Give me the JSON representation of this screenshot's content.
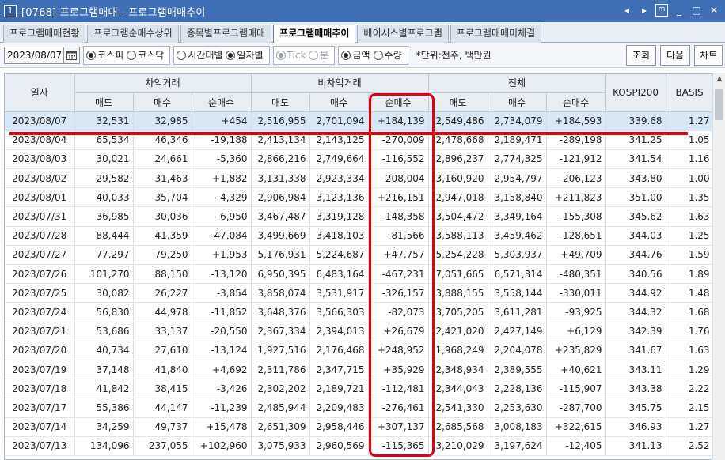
{
  "window": {
    "number": "1",
    "title": "[0768] 프로그램매매 - 프로그램매매추이",
    "controls": [
      "◂",
      "▸",
      "m",
      "_",
      "□",
      "✕"
    ]
  },
  "tabs": [
    {
      "label": "프로그램매매현황",
      "active": false
    },
    {
      "label": "프로그램순매수상위",
      "active": false
    },
    {
      "label": "종목별프로그램매매",
      "active": false
    },
    {
      "label": "프로그램매매추이",
      "active": true
    },
    {
      "label": "베이시스별프로그램",
      "active": false
    },
    {
      "label": "프로그램매매미체결",
      "active": false
    }
  ],
  "toolbar": {
    "date_value": "2023/08/07",
    "market": [
      {
        "label": "코스피",
        "selected": true
      },
      {
        "label": "코스닥",
        "selected": false
      }
    ],
    "period": [
      {
        "label": "시간대별",
        "selected": false
      },
      {
        "label": "일자별",
        "selected": true
      }
    ],
    "tick": [
      {
        "label": "Tick",
        "selected": true
      },
      {
        "label": "분",
        "selected": false
      }
    ],
    "amount_type": [
      {
        "label": "금액",
        "selected": true
      },
      {
        "label": "수량",
        "selected": false
      }
    ],
    "unit_note": "*단위:천주, 백만원",
    "search_label": "조회",
    "next_label": "다음",
    "chart_label": "차트"
  },
  "grid": {
    "headers": {
      "date": "일자",
      "arbitrage": "차익거래",
      "non_arbitrage": "비차익거래",
      "total": "전체",
      "kospi200": "KOSPI200",
      "basis": "BASIS",
      "sell": "매도",
      "buy": "매수",
      "net": "순매수"
    },
    "rows": [
      {
        "date": "2023/08/07",
        "a_sell": "32,531",
        "a_buy": "32,985",
        "a_net": "+454",
        "n_sell": "2,516,955",
        "n_buy": "2,701,094",
        "n_net": "+184,139",
        "t_sell": "2,549,486",
        "t_buy": "2,734,079",
        "t_net": "+184,593",
        "kospi": "339.68",
        "basis": "1.27"
      },
      {
        "date": "2023/08/04",
        "a_sell": "65,534",
        "a_buy": "46,346",
        "a_net": "-19,188",
        "n_sell": "2,413,134",
        "n_buy": "2,143,125",
        "n_net": "-270,009",
        "t_sell": "2,478,668",
        "t_buy": "2,189,471",
        "t_net": "-289,198",
        "kospi": "341.25",
        "basis": "1.05"
      },
      {
        "date": "2023/08/03",
        "a_sell": "30,021",
        "a_buy": "24,661",
        "a_net": "-5,360",
        "n_sell": "2,866,216",
        "n_buy": "2,749,664",
        "n_net": "-116,552",
        "t_sell": "2,896,237",
        "t_buy": "2,774,325",
        "t_net": "-121,912",
        "kospi": "341.54",
        "basis": "1.16"
      },
      {
        "date": "2023/08/02",
        "a_sell": "29,582",
        "a_buy": "31,463",
        "a_net": "+1,882",
        "n_sell": "3,131,338",
        "n_buy": "2,923,334",
        "n_net": "-208,004",
        "t_sell": "3,160,920",
        "t_buy": "2,954,797",
        "t_net": "-206,123",
        "kospi": "343.80",
        "basis": "1.00"
      },
      {
        "date": "2023/08/01",
        "a_sell": "40,033",
        "a_buy": "35,704",
        "a_net": "-4,329",
        "n_sell": "2,906,984",
        "n_buy": "3,123,136",
        "n_net": "+216,151",
        "t_sell": "2,947,018",
        "t_buy": "3,158,840",
        "t_net": "+211,823",
        "kospi": "351.00",
        "basis": "1.35"
      },
      {
        "date": "2023/07/31",
        "a_sell": "36,985",
        "a_buy": "30,036",
        "a_net": "-6,950",
        "n_sell": "3,467,487",
        "n_buy": "3,319,128",
        "n_net": "-148,358",
        "t_sell": "3,504,472",
        "t_buy": "3,349,164",
        "t_net": "-155,308",
        "kospi": "345.62",
        "basis": "1.63"
      },
      {
        "date": "2023/07/28",
        "a_sell": "88,444",
        "a_buy": "41,359",
        "a_net": "-47,084",
        "n_sell": "3,499,669",
        "n_buy": "3,418,103",
        "n_net": "-81,566",
        "t_sell": "3,588,113",
        "t_buy": "3,459,462",
        "t_net": "-128,651",
        "kospi": "344.03",
        "basis": "1.25"
      },
      {
        "date": "2023/07/27",
        "a_sell": "77,297",
        "a_buy": "79,250",
        "a_net": "+1,953",
        "n_sell": "5,176,931",
        "n_buy": "5,224,687",
        "n_net": "+47,757",
        "t_sell": "5,254,228",
        "t_buy": "5,303,937",
        "t_net": "+49,709",
        "kospi": "344.76",
        "basis": "1.59"
      },
      {
        "date": "2023/07/26",
        "a_sell": "101,270",
        "a_buy": "88,150",
        "a_net": "-13,120",
        "n_sell": "6,950,395",
        "n_buy": "6,483,164",
        "n_net": "-467,231",
        "t_sell": "7,051,665",
        "t_buy": "6,571,314",
        "t_net": "-480,351",
        "kospi": "340.56",
        "basis": "1.89"
      },
      {
        "date": "2023/07/25",
        "a_sell": "30,082",
        "a_buy": "26,227",
        "a_net": "-3,854",
        "n_sell": "3,858,074",
        "n_buy": "3,531,917",
        "n_net": "-326,157",
        "t_sell": "3,888,155",
        "t_buy": "3,558,144",
        "t_net": "-330,011",
        "kospi": "344.92",
        "basis": "1.48"
      },
      {
        "date": "2023/07/24",
        "a_sell": "56,830",
        "a_buy": "44,978",
        "a_net": "-11,852",
        "n_sell": "3,648,376",
        "n_buy": "3,566,303",
        "n_net": "-82,073",
        "t_sell": "3,705,205",
        "t_buy": "3,611,281",
        "t_net": "-93,925",
        "kospi": "344.32",
        "basis": "1.68"
      },
      {
        "date": "2023/07/21",
        "a_sell": "53,686",
        "a_buy": "33,137",
        "a_net": "-20,550",
        "n_sell": "2,367,334",
        "n_buy": "2,394,013",
        "n_net": "+26,679",
        "t_sell": "2,421,020",
        "t_buy": "2,427,149",
        "t_net": "+6,129",
        "kospi": "342.39",
        "basis": "1.76"
      },
      {
        "date": "2023/07/20",
        "a_sell": "40,734",
        "a_buy": "27,610",
        "a_net": "-13,124",
        "n_sell": "1,927,516",
        "n_buy": "2,176,468",
        "n_net": "+248,952",
        "t_sell": "1,968,249",
        "t_buy": "2,204,078",
        "t_net": "+235,829",
        "kospi": "341.67",
        "basis": "1.63"
      },
      {
        "date": "2023/07/19",
        "a_sell": "37,148",
        "a_buy": "41,840",
        "a_net": "+4,692",
        "n_sell": "2,311,786",
        "n_buy": "2,347,715",
        "n_net": "+35,929",
        "t_sell": "2,348,934",
        "t_buy": "2,389,555",
        "t_net": "+40,621",
        "kospi": "343.11",
        "basis": "1.29"
      },
      {
        "date": "2023/07/18",
        "a_sell": "41,842",
        "a_buy": "38,415",
        "a_net": "-3,426",
        "n_sell": "2,302,202",
        "n_buy": "2,189,721",
        "n_net": "-112,481",
        "t_sell": "2,344,043",
        "t_buy": "2,228,136",
        "t_net": "-115,907",
        "kospi": "343.38",
        "basis": "2.22"
      },
      {
        "date": "2023/07/17",
        "a_sell": "55,386",
        "a_buy": "44,147",
        "a_net": "-11,239",
        "n_sell": "2,485,944",
        "n_buy": "2,209,483",
        "n_net": "-276,461",
        "t_sell": "2,541,330",
        "t_buy": "2,253,630",
        "t_net": "-287,700",
        "kospi": "345.75",
        "basis": "2.15"
      },
      {
        "date": "2023/07/14",
        "a_sell": "34,259",
        "a_buy": "49,737",
        "a_net": "+15,478",
        "n_sell": "2,651,309",
        "n_buy": "2,958,446",
        "n_net": "+307,137",
        "t_sell": "2,685,568",
        "t_buy": "3,008,183",
        "t_net": "+322,615",
        "kospi": "346.93",
        "basis": "1.27"
      },
      {
        "date": "2023/07/13",
        "a_sell": "134,096",
        "a_buy": "237,055",
        "a_net": "+102,960",
        "n_sell": "3,075,933",
        "n_buy": "2,960,569",
        "n_net": "-115,365",
        "t_sell": "3,210,029",
        "t_buy": "3,197,624",
        "t_net": "-12,405",
        "kospi": "341.13",
        "basis": "2.52"
      }
    ]
  },
  "colors": {
    "title_bar": "#3f6fb7",
    "positive": "#e8212b",
    "negative": "#2450c4",
    "selected_row": "#d6e8f6",
    "annotation": "#e1000f"
  }
}
